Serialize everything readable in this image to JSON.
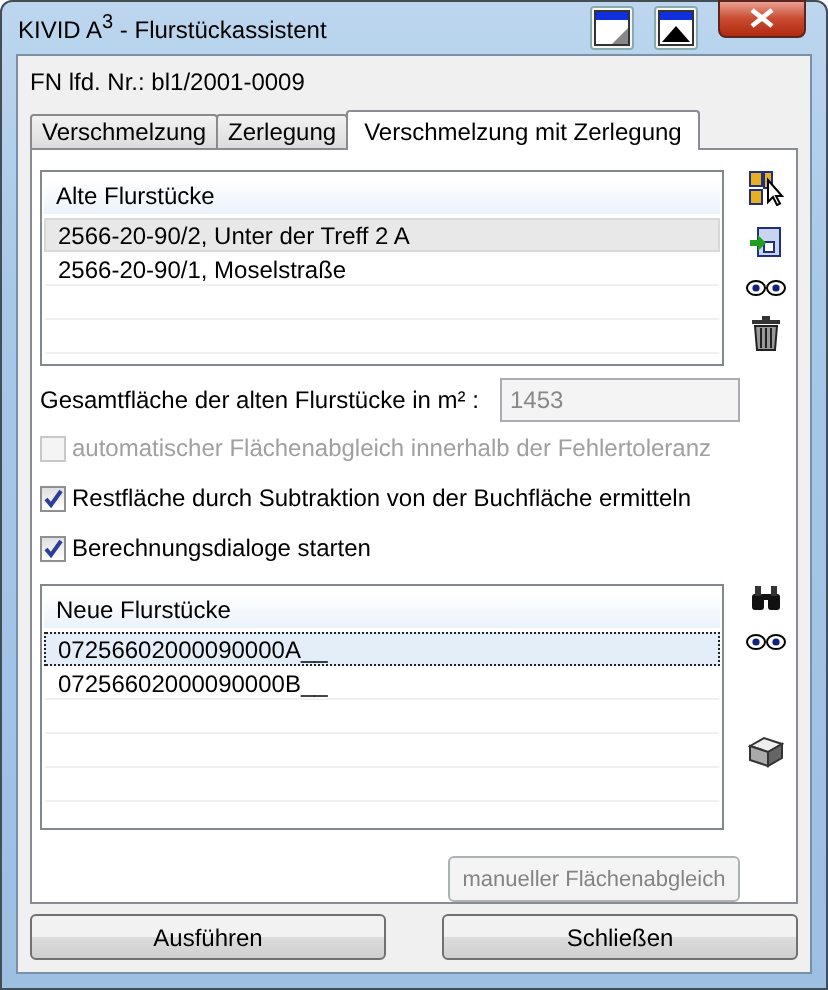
{
  "window": {
    "title": "KIVID A$^{3}$ - Flurstückassistent"
  },
  "fn_label": "FN lfd. Nr.: bl1/2001-0009",
  "tabs": [
    {
      "label": "Verschmelzung",
      "selected": false
    },
    {
      "label": "Zerlegung",
      "selected": false
    },
    {
      "label": "Verschmelzung mit Zerlegung",
      "selected": true
    }
  ],
  "old_parcels": {
    "header": "Alte Flurstücke",
    "rows": [
      {
        "text": "2566-20-90/2, Unter der Treff  2 A",
        "selected": true
      },
      {
        "text": "2566-20-90/1, Moselstraße",
        "selected": false
      }
    ]
  },
  "total_area": {
    "label": "Gesamtfläche der alten Flurstücke in m² :",
    "value": "1453"
  },
  "options": [
    {
      "label": "automatischer Flächenabgleich innerhalb der Fehlertoleranz",
      "checked": false,
      "disabled": true
    },
    {
      "label": "Restfläche durch Subtraktion von der Buchfläche ermitteln",
      "checked": true,
      "disabled": false
    },
    {
      "label": "Berechnungsdialoge starten",
      "checked": true,
      "disabled": false
    }
  ],
  "new_parcels": {
    "header": "Neue Flurstücke",
    "rows": [
      {
        "text": "07256602000090000A__",
        "selected": true
      },
      {
        "text": "07256602000090000B__",
        "selected": false
      }
    ]
  },
  "manual_button": {
    "label": "manueller Flächenabgleich",
    "disabled": true
  },
  "buttons": [
    "Ausführen",
    "Schließen"
  ]
}
